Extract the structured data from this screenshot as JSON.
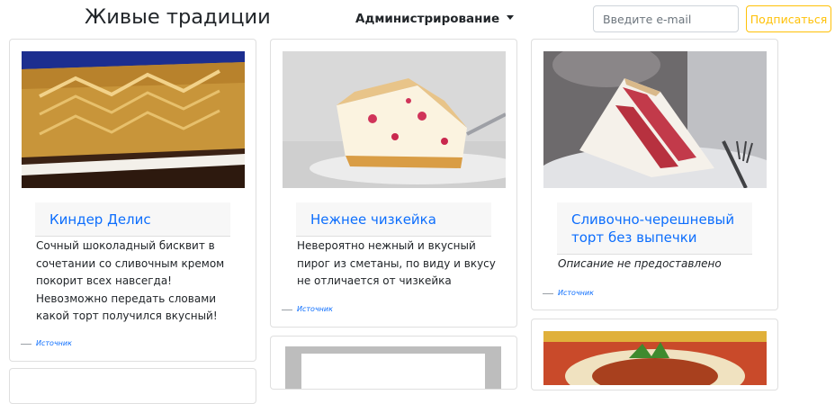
{
  "header": {
    "brand": "Живые традиции",
    "admin_menu_label": "Администрирование",
    "email_placeholder": "Введите e-mail",
    "subscribe_label": "Подписаться"
  },
  "cards": [
    {
      "title": "Киндер Делис",
      "description": "Сочный шоколадный бисквит в сочетании со сливочным кремом покорит всех навсегда! Невозможно передать словами какой торт получился вкусный!",
      "source_label": "Источник"
    },
    {
      "title": "Нежнее чизкейка",
      "description": "Невероятно нежный и вкусный пирог из сметаны, по виду и вкусу не отличается от чизкейка",
      "source_label": "Источник"
    },
    {
      "title": "Сливочно-черешневый торт без выпечки",
      "description": "Описание не предоставлено",
      "source_label": "Источник"
    }
  ],
  "colors": {
    "link": "#0d6efd",
    "subscribe_accent": "#ffc107",
    "card_title_bg": "#f7f7f7"
  }
}
